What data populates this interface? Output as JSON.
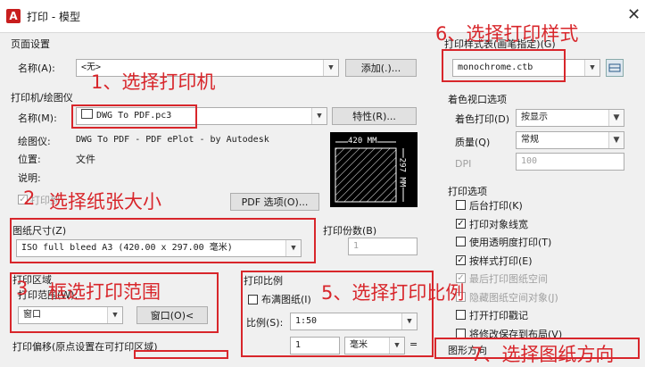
{
  "window": {
    "title": "打印 - 模型",
    "logo": "A"
  },
  "page_setup": {
    "group": "页面设置",
    "name_label": "名称(A):",
    "name_value": "<无>",
    "add_button": "添加(.)..."
  },
  "printer": {
    "group": "打印机/绘图仪",
    "name_label": "名称(M):",
    "name_value": "DWG To PDF.pc3",
    "properties_button": "特性(R)...",
    "plotter_label": "绘图仪:",
    "plotter_value": "DWG To PDF - PDF ePlot - by Autodesk",
    "location_label": "位置:",
    "location_value": "文件",
    "description_label": "说明:",
    "print_to_file": "打印到",
    "pdf_options_button": "PDF 选项(O)...",
    "preview_width": "420 MM",
    "preview_height": "297 MM"
  },
  "paper": {
    "group": "图纸尺寸(Z)",
    "value": "ISO full bleed A3 (420.00 x 297.00 毫米)"
  },
  "copies": {
    "label": "打印份数(B)",
    "value": "1"
  },
  "plot_area": {
    "group": "打印区域",
    "range_label": "打印范围(W):",
    "range_value": "窗口",
    "window_button": "窗口(O)<"
  },
  "plot_scale": {
    "group": "打印比例",
    "fit_label": "布满图纸(I)",
    "scale_label": "比例(S):",
    "scale_value": "1:50",
    "unit_value": "1",
    "unit_label": "毫米"
  },
  "plot_offset": {
    "label": "打印偏移(原点设置在可打印区域)"
  },
  "style_table": {
    "group": "打印样式表(画笔指定)(G)",
    "value": "monochrome.ctb"
  },
  "shaded": {
    "group": "着色视口选项",
    "shade_label": "着色打印(D)",
    "shade_value": "按显示",
    "quality_label": "质量(Q)",
    "quality_value": "常规",
    "dpi_label": "DPI",
    "dpi_value": "100"
  },
  "options": {
    "group": "打印选项",
    "items": [
      {
        "label": "后台打印(K)",
        "checked": false,
        "disabled": false
      },
      {
        "label": "打印对象线宽",
        "checked": true,
        "disabled": false
      },
      {
        "label": "使用透明度打印(T)",
        "checked": false,
        "disabled": false
      },
      {
        "label": "按样式打印(E)",
        "checked": true,
        "disabled": false
      },
      {
        "label": "最后打印图纸空间",
        "checked": true,
        "disabled": true
      },
      {
        "label": "隐藏图纸空间对象(J)",
        "checked": false,
        "disabled": true
      },
      {
        "label": "打开打印戳记",
        "checked": false,
        "disabled": false
      },
      {
        "label": "将修改保存到布局(V)",
        "checked": false,
        "disabled": false
      }
    ]
  },
  "orientation": {
    "group": "图形方向"
  },
  "annotations": {
    "a1": "1、选择打印机",
    "a2_num": "2",
    "a2": "选择纸张大小",
    "a3_num": "3",
    "a3": "框选打印范围",
    "a5": "5、选择打印比例",
    "a6": "6、选择打印样式",
    "a7": "7、选择图纸方向"
  },
  "colors": {
    "annotation": "#d8262b",
    "window_bg": "#f0f0f0"
  },
  "icons": [
    "autocad-logo-icon",
    "close-icon",
    "printer-icon",
    "edit-style-icon",
    "dropdown-arrow-icon"
  ]
}
